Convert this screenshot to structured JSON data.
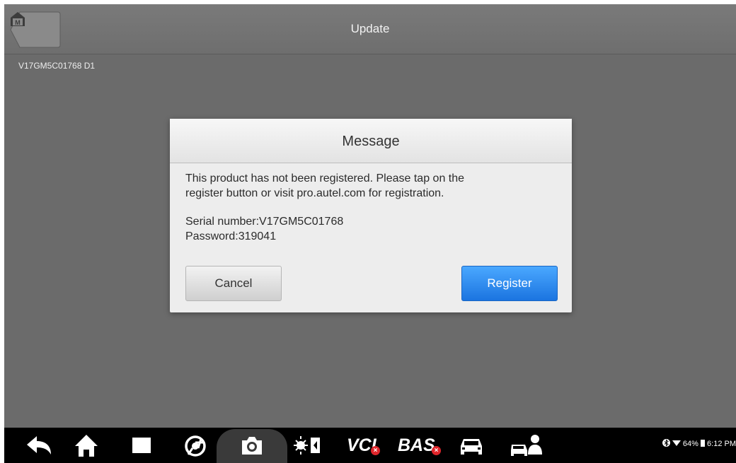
{
  "header": {
    "title": "Update",
    "home_icon": "home-m-icon"
  },
  "device": {
    "serial_line": "V17GM5C01768  D1"
  },
  "dialog": {
    "title": "Message",
    "message_line1": "This product has not been registered. Please tap on the",
    "message_line2": "register button or visit pro.autel.com for registration.",
    "serial": "Serial number:V17GM5C01768",
    "password": "Password:319041",
    "cancel_label": "Cancel",
    "register_label": "Register"
  },
  "navbar": {
    "items": [
      "back-icon",
      "home-icon",
      "recent-apps-icon",
      "chrome-icon",
      "camera-icon",
      "display-icon",
      "vci-icon",
      "bas-icon",
      "car-icon",
      "remote-support-icon"
    ],
    "vci_label": "VCI",
    "bas_label": "BAS"
  },
  "status": {
    "battery": "64%",
    "time": "6:12 PM"
  },
  "colors": {
    "register_blue": "#1b74e0",
    "badge_red": "#e0262b",
    "background": "#6b6b6b"
  }
}
